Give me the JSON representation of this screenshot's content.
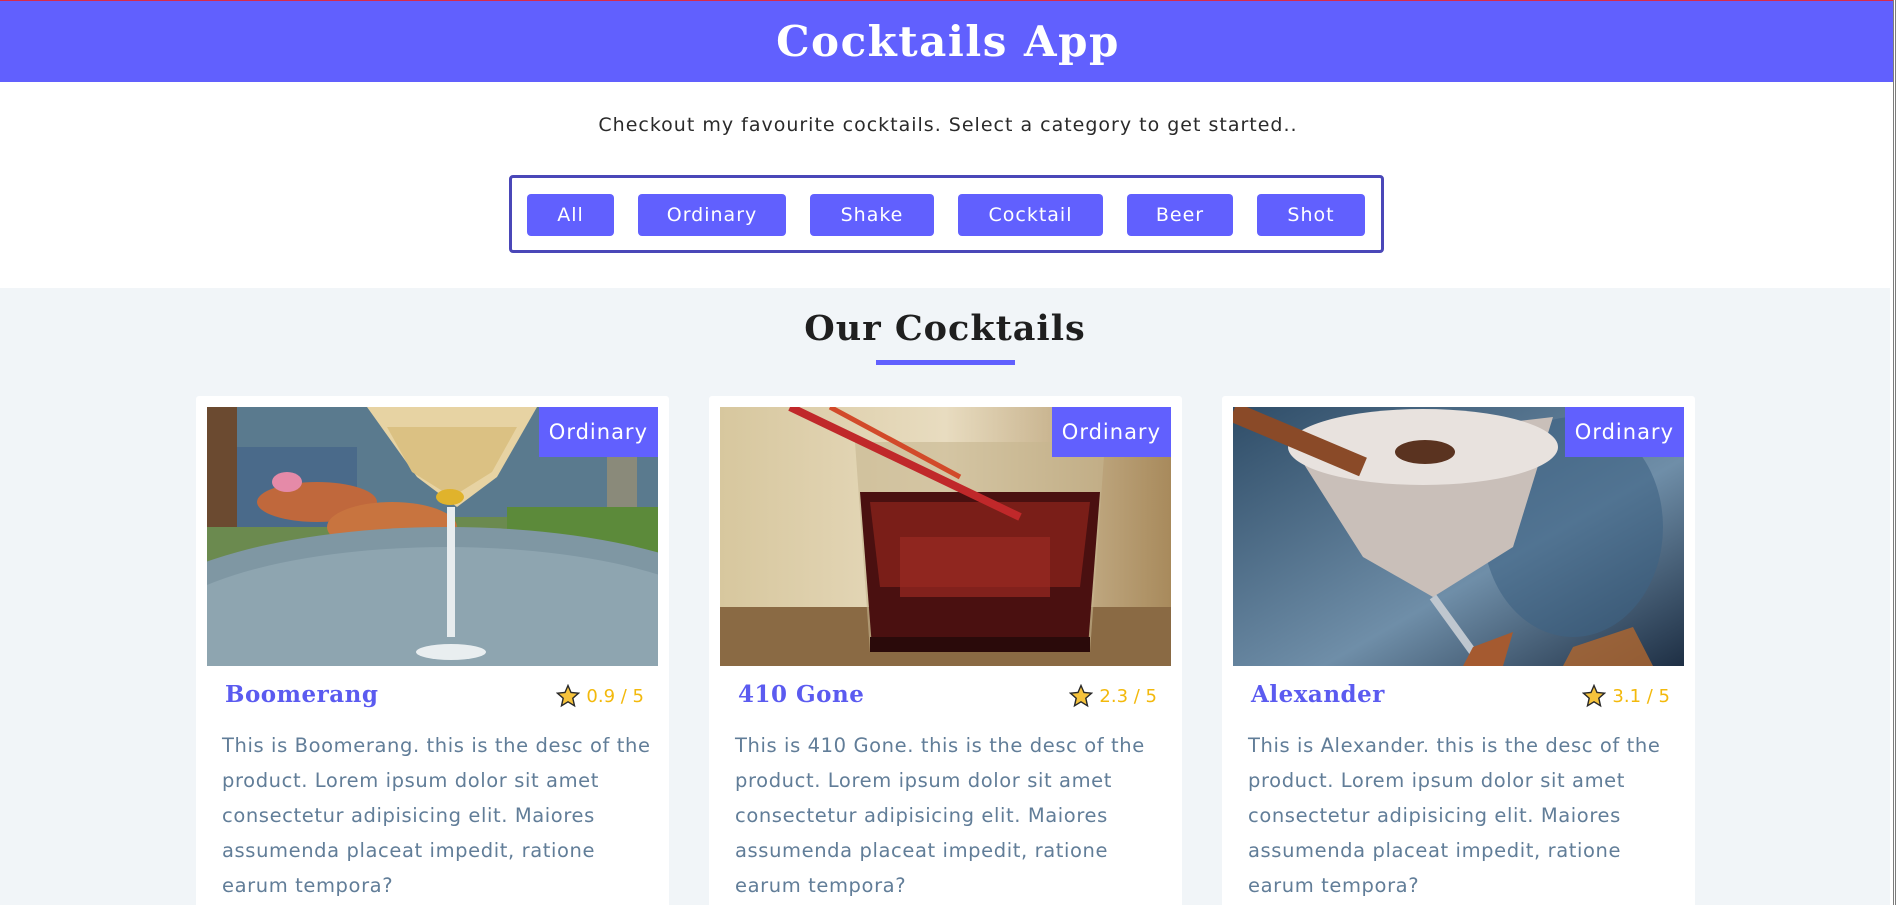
{
  "header": {
    "title": "Cocktails App"
  },
  "intro": {
    "subtitle": "Checkout my favourite cocktails. Select a category to get started.."
  },
  "filters": [
    {
      "label": "All"
    },
    {
      "label": "Ordinary"
    },
    {
      "label": "Shake"
    },
    {
      "label": "Cocktail"
    },
    {
      "label": "Beer"
    },
    {
      "label": "Shot"
    }
  ],
  "section": {
    "title": "Our Cocktails"
  },
  "cards": [
    {
      "name": "Boomerang",
      "category": "Ordinary",
      "rating": "0.9 / 5",
      "description": "This is Boomerang. this is the desc of the product. Lorem ipsum dolor sit amet consectetur adipisicing elit. Maiores assumenda placeat impedit, ratione earum tempora?"
    },
    {
      "name": "410 Gone",
      "category": "Ordinary",
      "rating": "2.3 / 5",
      "description": "This is 410 Gone. this is the desc of the product. Lorem ipsum dolor sit amet consectetur adipisicing elit. Maiores assumenda placeat impedit, ratione earum tempora?"
    },
    {
      "name": "Alexander",
      "category": "Ordinary",
      "rating": "3.1 / 5",
      "description": "This is Alexander. this is the desc of the product. Lorem ipsum dolor sit amet consectetur adipisicing elit. Maiores assumenda placeat impedit, ratione earum tempora?"
    }
  ],
  "colors": {
    "primary": "#6160fe",
    "section_bg": "#f1f5f8",
    "rating": "#f3b90c",
    "desc_text": "#617d98"
  },
  "icons": {
    "rating": "star-icon"
  }
}
